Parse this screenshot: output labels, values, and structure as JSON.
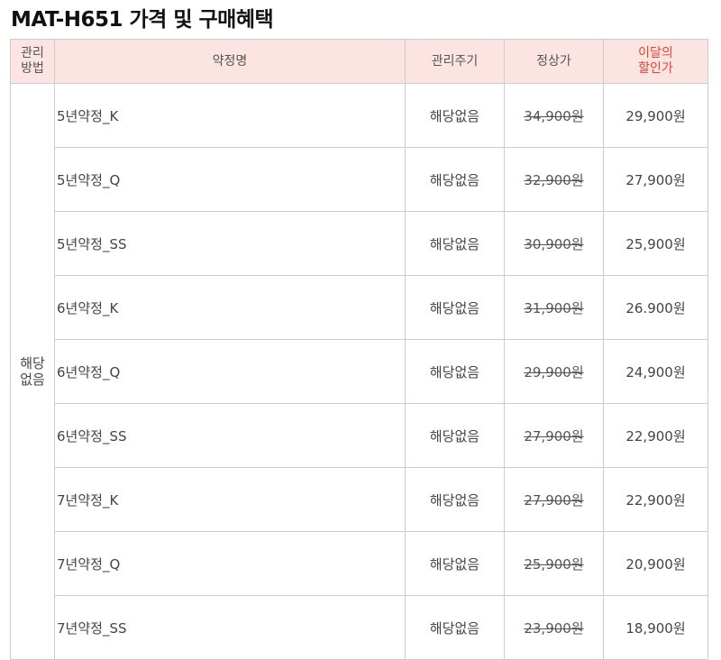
{
  "title": "MAT-H651 가격 및 구매혜택",
  "headers": {
    "method": [
      "관리",
      "방법"
    ],
    "plan": "약정명",
    "cycle": "관리주기",
    "regular": "정상가",
    "discount": [
      "이달의",
      "할인가"
    ]
  },
  "method_value": [
    "해당",
    "없음"
  ],
  "rows": [
    {
      "plan": "5년약정_K",
      "cycle": "해당없음",
      "regular": "34,900원",
      "discount": "29,900원"
    },
    {
      "plan": "5년약정_Q",
      "cycle": "해당없음",
      "regular": "32,900원",
      "discount": "27,900원"
    },
    {
      "plan": "5년약정_SS",
      "cycle": "해당없음",
      "regular": "30,900원",
      "discount": "25,900원"
    },
    {
      "plan": "6년약정_K",
      "cycle": "해당없음",
      "regular": "31,900원",
      "discount": "26.900원"
    },
    {
      "plan": "6년약정_Q",
      "cycle": "해당없음",
      "regular": "29,900원",
      "discount": "24,900원"
    },
    {
      "plan": "6년약정_SS",
      "cycle": "해당없음",
      "regular": "27,900원",
      "discount": "22,900원"
    },
    {
      "plan": "7년약정_K",
      "cycle": "해당없음",
      "regular": "27,900원",
      "discount": "22,900원"
    },
    {
      "plan": "7년약정_Q",
      "cycle": "해당없음",
      "regular": "25,900원",
      "discount": "20,900원"
    },
    {
      "plan": "7년약정_SS",
      "cycle": "해당없음",
      "regular": "23,900원",
      "discount": "18,900원"
    }
  ],
  "colors": {
    "header_bg": "#fbe4e2",
    "accent_red": "#e8432f",
    "border": "#cccccc"
  }
}
